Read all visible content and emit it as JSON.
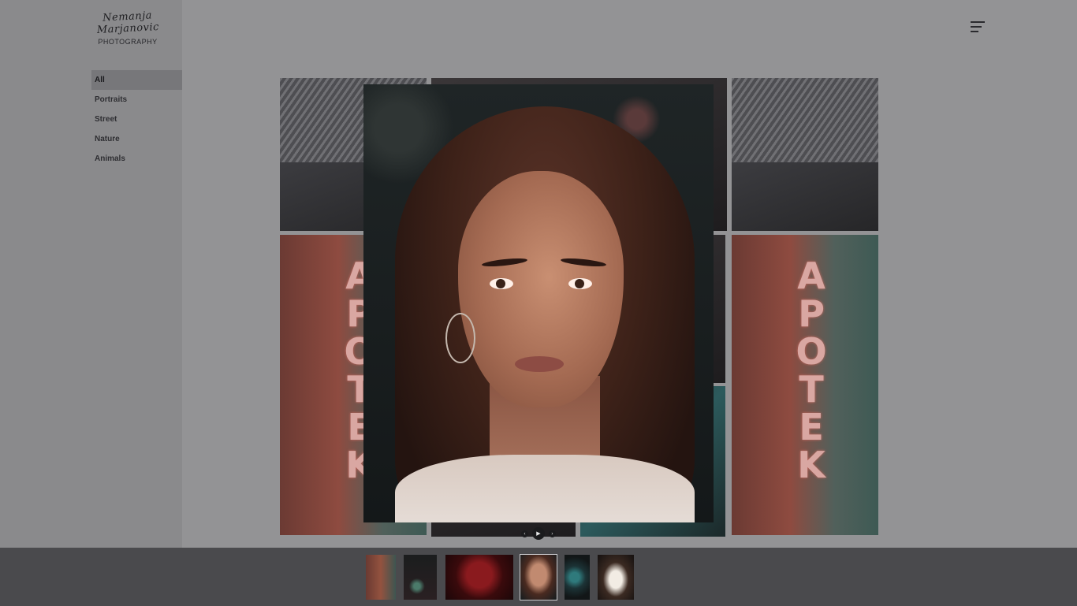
{
  "brand": {
    "script_name": "Nemanja Marjanovic",
    "sub": "PHOTOGRAPHY"
  },
  "nav": {
    "items": [
      {
        "label": "All",
        "active": true
      },
      {
        "label": "Portraits",
        "active": false
      },
      {
        "label": "Street",
        "active": false
      },
      {
        "label": "Nature",
        "active": false
      },
      {
        "label": "Animals",
        "active": false
      }
    ]
  },
  "header": {
    "menu_icon": "hamburger-menu-icon"
  },
  "gallery": {
    "tiles": [
      {
        "subject": "building"
      },
      {
        "subject": "building"
      },
      {
        "subject": "apotek sign",
        "text": "APOTEK"
      },
      {
        "subject": "apotek sign",
        "text": "APOTEK"
      },
      {
        "subject": "dark"
      },
      {
        "subject": "teal leaves"
      }
    ]
  },
  "lightbox": {
    "current_photo": "portrait of woman with long brown hair",
    "controls": {
      "prev_icon": "chevron-left-icon",
      "play_icon": "play-icon",
      "next_icon": "chevron-right-icon",
      "prev_glyph": "‹",
      "play_glyph": "▶",
      "next_glyph": "›"
    },
    "thumbnails": [
      {
        "subject": "apotek sign",
        "active": false
      },
      {
        "subject": "street at night",
        "active": false
      },
      {
        "subject": "red rose",
        "active": false
      },
      {
        "subject": "portrait",
        "active": true
      },
      {
        "subject": "teal leaves",
        "active": false
      },
      {
        "subject": "dog",
        "active": false
      }
    ]
  },
  "colors": {
    "overlay": "#939395",
    "sidebar": "#8a8a8c",
    "active_nav": "#77777a",
    "thumb_strip": "#4a4a4d"
  }
}
